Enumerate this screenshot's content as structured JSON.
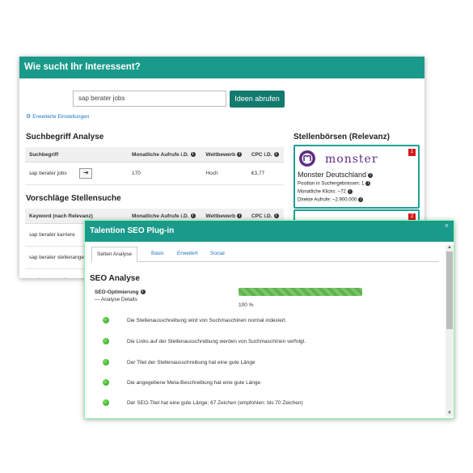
{
  "w1": {
    "title": "Wie sucht Ihr Interessent?",
    "search": {
      "value": "sap berater jobs"
    },
    "button": "Ideen abrufen",
    "advanced": "Erweiterte Einstellungen",
    "analysis": {
      "heading": "Suchbegriff Analyse",
      "headers": [
        "Suchbegriff",
        "Monatliche Aufrufe i.D.",
        "Wettbewerb",
        "CPC i.D."
      ],
      "row": [
        "sap berater jobs",
        "170",
        "Hoch",
        "€3,77"
      ]
    },
    "suggestions": {
      "heading": "Vorschläge Stellensuche",
      "headers": [
        "Keyword (nach Relevanz)",
        "Monatliche Aufrufe i.D.",
        "Wettbewerb",
        "CPC i.D."
      ],
      "rows": [
        "sap berater karriere",
        "sap berater stellenange",
        "sap berater stellenanze"
      ]
    },
    "boards": {
      "heading": "Stellenbörsen (Relevanz)",
      "card": {
        "badge": "1",
        "logo_word": "monster",
        "name": "Monster Deutschland",
        "lines": [
          "Position in Suchergebnissen: 1",
          "Monatliche Klicks: ~72",
          "Direkte Aufrufe: ~2.900.000"
        ]
      },
      "card2_badge": "2"
    }
  },
  "w2": {
    "title": "Talention SEO Plug-in",
    "close": "×",
    "tabs": [
      "Seiten Analyse",
      "Basic",
      "Erweitert",
      "Social"
    ],
    "heading": "SEO Analyse",
    "opt_label": "SEO-Optimierung",
    "details": "Analyse Details",
    "progress": 100,
    "percent_label": "100 %",
    "checks": [
      "Die Stellenausschreibung wird von Suchmaschinen normal indexiert.",
      "Die Links auf der Stellenausschreibung werden von Suchmaschinen verfolgt.",
      "Der Titel der Stellenausschreibung hat eine gute Länge",
      "Die angegebene Meta-Beschreibung hat eine gute Länge",
      "Der SEO-Titel hat eine gute Länge: 67 Zeichen (empfohlen: bis 70 Zeichen)"
    ]
  },
  "colors": {
    "header": "#1a9a8a",
    "button": "#137a6e",
    "link": "#1e73be",
    "badge": "#d61c1c",
    "success": "#2c9a1c"
  },
  "icons": [
    "info-icon",
    "arrow-right-icon",
    "gear-icon",
    "close-icon",
    "check-dot-icon",
    "monster-logo-icon"
  ]
}
